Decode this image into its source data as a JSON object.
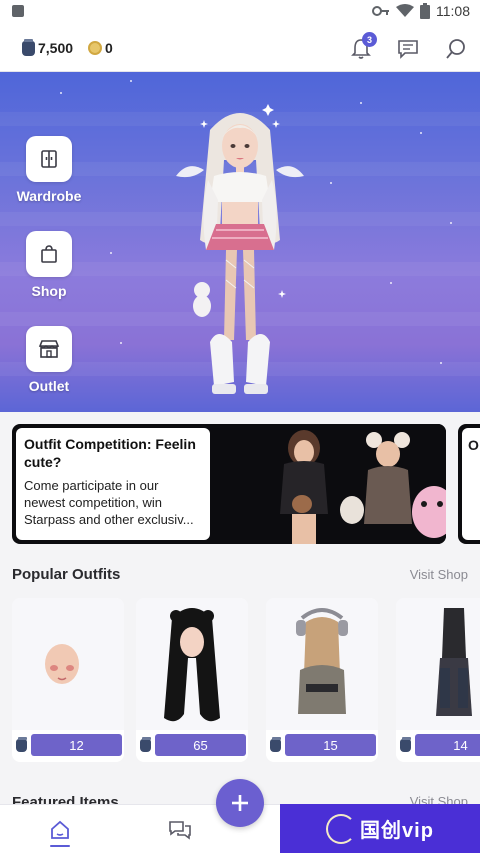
{
  "status_bar": {
    "time": "11:08"
  },
  "top_bar": {
    "gems": "7,500",
    "coins": "0",
    "notification_count": "3"
  },
  "hero": {
    "side_buttons": [
      {
        "label": "Wardrobe",
        "icon": "wardrobe-icon"
      },
      {
        "label": "Shop",
        "icon": "shopping-bag-icon"
      },
      {
        "label": "Outlet",
        "icon": "storefront-icon"
      }
    ]
  },
  "competitions": [
    {
      "title": "Outfit Competition: Feelin cute?",
      "description": "Come participate in our newest competition, win Starpass and other exclusiv..."
    },
    {
      "title": "O Ti"
    }
  ],
  "popular": {
    "title": "Popular Outfits",
    "link": "Visit Shop",
    "items": [
      {
        "price": "12"
      },
      {
        "price": "65"
      },
      {
        "price": "15"
      },
      {
        "price": "14"
      }
    ]
  },
  "featured": {
    "title": "Featured Items",
    "link": "Visit Shop"
  },
  "watermark": {
    "text": "国创vip"
  },
  "colors": {
    "accent": "#5b5bd6",
    "price_pill": "#6e63c9",
    "hero_top": "#4f66d9",
    "hero_mid": "#8c7bdc"
  }
}
